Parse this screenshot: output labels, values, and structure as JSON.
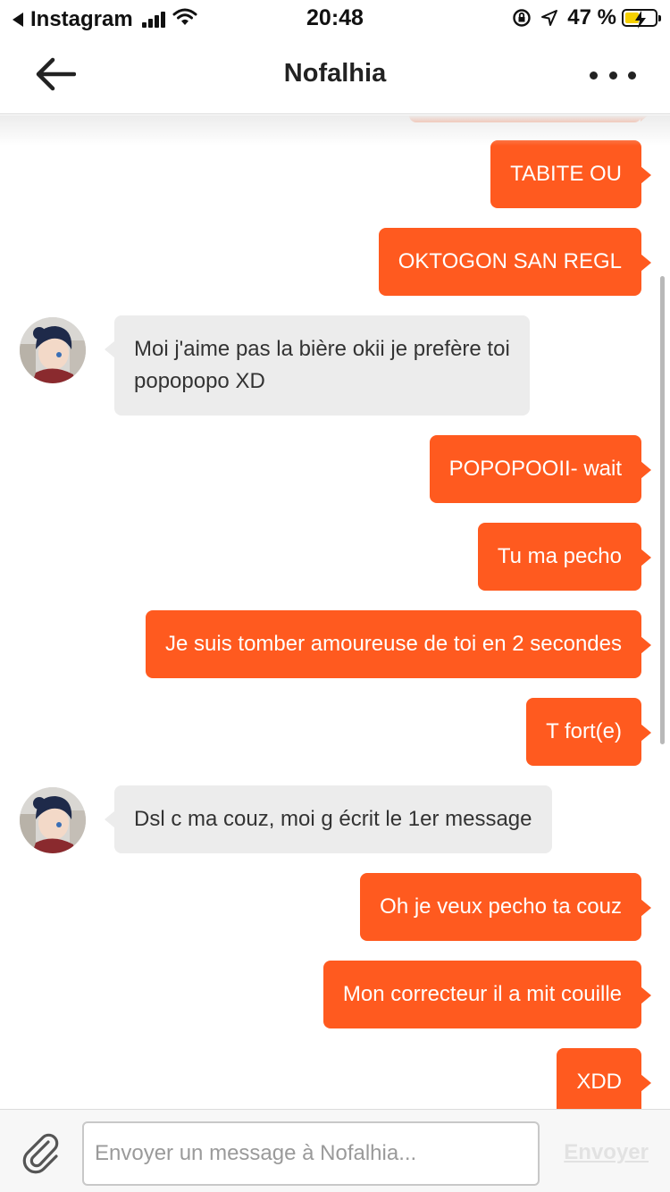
{
  "status_bar": {
    "back_app": "Instagram",
    "time": "20:48",
    "battery": "47 %",
    "icons": [
      "signal-icon",
      "wifi-icon",
      "orientation-lock-icon",
      "location-icon",
      "battery-icon"
    ]
  },
  "header": {
    "title": "Nofalhia",
    "icons": [
      "back-arrow-icon",
      "more-icon"
    ]
  },
  "messages": [
    {
      "from": "me",
      "text": ""
    },
    {
      "from": "me",
      "text": "TABITE OU"
    },
    {
      "from": "me",
      "text": "OKTOGON SAN REGL"
    },
    {
      "from": "them",
      "lines": [
        "Moi j'aime pas la bière okii je prefère toi",
        "popopopo XD"
      ]
    },
    {
      "from": "me",
      "text": "POPOPOOII- wait"
    },
    {
      "from": "me",
      "text": "Tu ma pecho"
    },
    {
      "from": "me",
      "text": "Je suis tomber amoureuse de toi en 2 secondes"
    },
    {
      "from": "me",
      "text": "T fort(e)"
    },
    {
      "from": "them",
      "text": "Dsl c ma couz, moi g écrit le 1er message"
    },
    {
      "from": "me",
      "text": "Oh je veux pecho ta couz"
    },
    {
      "from": "me",
      "text": "Mon correcteur il a mit couille"
    },
    {
      "from": "me",
      "text": "XDD"
    }
  ],
  "composer": {
    "placeholder": "Envoyer un message à Nofalhia...",
    "value": "",
    "send_label": "Envoyer",
    "attach_icon": "paperclip-icon"
  },
  "colors": {
    "outgoing_bubble": "#ff5a1f",
    "incoming_bubble": "#ececec",
    "send_disabled": "#e2e2e2"
  }
}
